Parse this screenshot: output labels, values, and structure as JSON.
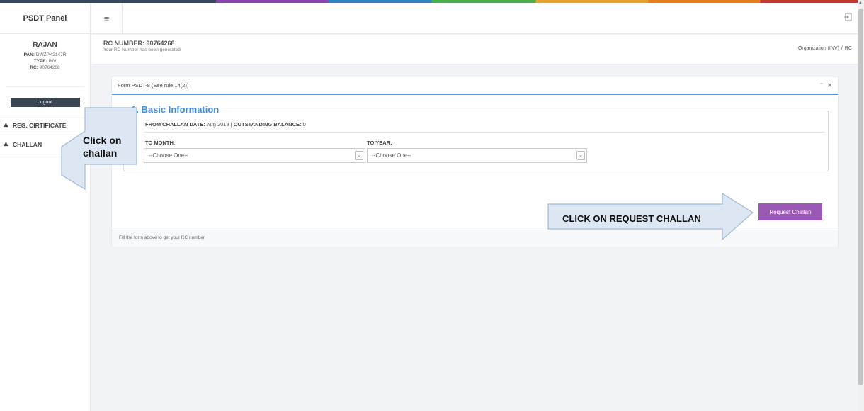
{
  "sidebar": {
    "brand": "PSDT Panel",
    "user": {
      "name": "RAJAN",
      "pan_label": "PAN:",
      "pan_value": "DWZPK2147R",
      "type_label": "TYPE:",
      "type_value": "INV",
      "rc_label": "RC:",
      "rc_value": "90764268"
    },
    "logout_label": "Logout",
    "nav": [
      {
        "icon": "car-icon",
        "label": "REG. CIRTIFICATE"
      },
      {
        "icon": "car-icon",
        "label": "CHALLAN"
      }
    ]
  },
  "topbar": {
    "menu_icon": "hamburger-icon",
    "exit_icon": "sign-out-icon"
  },
  "page_header": {
    "rc_number": "RC NUMBER: 90764268",
    "subtitle": "Your RC Number has been generated.",
    "breadcrumb": [
      "Organization (INV)",
      "/",
      "RC"
    ]
  },
  "form": {
    "title": "Form PSDT-8 (See rule 14(2))",
    "section_title": "1. Basic Information",
    "from_date_label": "FROM CHALLAN DATE:",
    "from_date_value": "Aug 2018",
    "separator": "|",
    "balance_label": "OUTSTANDING BALANCE:",
    "balance_value": "0",
    "to_month_label": "TO MONTH:",
    "to_month_value": "--Choose One--",
    "to_year_label": "TO YEAR:",
    "to_year_value": "--Choose One--",
    "request_button": "Request Challan",
    "footer": "Fill the form above to get your RC number"
  },
  "annotations": {
    "challan_callout_line1": "Click on",
    "challan_callout_line2": "challan",
    "request_callout": "CLICK ON REQUEST CHALLAN"
  },
  "colors": {
    "accent_blue": "#4f97d8",
    "button_purple": "#9b59b6",
    "logout_dark": "#3a4552",
    "callout_fill": "#dce7f3"
  }
}
